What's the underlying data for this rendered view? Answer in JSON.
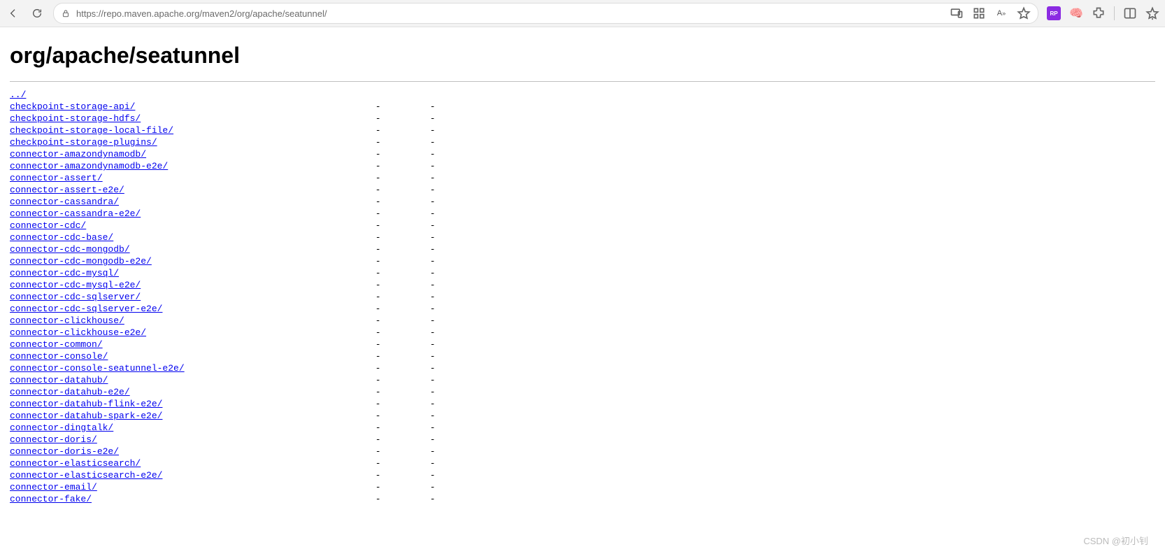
{
  "browser": {
    "url": "https://repo.maven.apache.org/maven2/org/apache/seatunnel/"
  },
  "page": {
    "heading": "org/apache/seatunnel",
    "parent_link": "../",
    "entries": [
      {
        "name": "checkpoint-storage-api/",
        "date": "-",
        "size": "-"
      },
      {
        "name": "checkpoint-storage-hdfs/",
        "date": "-",
        "size": "-"
      },
      {
        "name": "checkpoint-storage-local-file/",
        "date": "-",
        "size": "-"
      },
      {
        "name": "checkpoint-storage-plugins/",
        "date": "-",
        "size": "-"
      },
      {
        "name": "connector-amazondynamodb/",
        "date": "-",
        "size": "-"
      },
      {
        "name": "connector-amazondynamodb-e2e/",
        "date": "-",
        "size": "-"
      },
      {
        "name": "connector-assert/",
        "date": "-",
        "size": "-"
      },
      {
        "name": "connector-assert-e2e/",
        "date": "-",
        "size": "-"
      },
      {
        "name": "connector-cassandra/",
        "date": "-",
        "size": "-"
      },
      {
        "name": "connector-cassandra-e2e/",
        "date": "-",
        "size": "-"
      },
      {
        "name": "connector-cdc/",
        "date": "-",
        "size": "-"
      },
      {
        "name": "connector-cdc-base/",
        "date": "-",
        "size": "-"
      },
      {
        "name": "connector-cdc-mongodb/",
        "date": "-",
        "size": "-"
      },
      {
        "name": "connector-cdc-mongodb-e2e/",
        "date": "-",
        "size": "-"
      },
      {
        "name": "connector-cdc-mysql/",
        "date": "-",
        "size": "-"
      },
      {
        "name": "connector-cdc-mysql-e2e/",
        "date": "-",
        "size": "-"
      },
      {
        "name": "connector-cdc-sqlserver/",
        "date": "-",
        "size": "-"
      },
      {
        "name": "connector-cdc-sqlserver-e2e/",
        "date": "-",
        "size": "-"
      },
      {
        "name": "connector-clickhouse/",
        "date": "-",
        "size": "-"
      },
      {
        "name": "connector-clickhouse-e2e/",
        "date": "-",
        "size": "-"
      },
      {
        "name": "connector-common/",
        "date": "-",
        "size": "-"
      },
      {
        "name": "connector-console/",
        "date": "-",
        "size": "-"
      },
      {
        "name": "connector-console-seatunnel-e2e/",
        "date": "-",
        "size": "-"
      },
      {
        "name": "connector-datahub/",
        "date": "-",
        "size": "-"
      },
      {
        "name": "connector-datahub-e2e/",
        "date": "-",
        "size": "-"
      },
      {
        "name": "connector-datahub-flink-e2e/",
        "date": "-",
        "size": "-"
      },
      {
        "name": "connector-datahub-spark-e2e/",
        "date": "-",
        "size": "-"
      },
      {
        "name": "connector-dingtalk/",
        "date": "-",
        "size": "-"
      },
      {
        "name": "connector-doris/",
        "date": "-",
        "size": "-"
      },
      {
        "name": "connector-doris-e2e/",
        "date": "-",
        "size": "-"
      },
      {
        "name": "connector-elasticsearch/",
        "date": "-",
        "size": "-"
      },
      {
        "name": "connector-elasticsearch-e2e/",
        "date": "-",
        "size": "-"
      },
      {
        "name": "connector-email/",
        "date": "-",
        "size": "-"
      },
      {
        "name": "connector-fake/",
        "date": "-",
        "size": "-"
      }
    ]
  },
  "watermark": "CSDN @初小钊"
}
